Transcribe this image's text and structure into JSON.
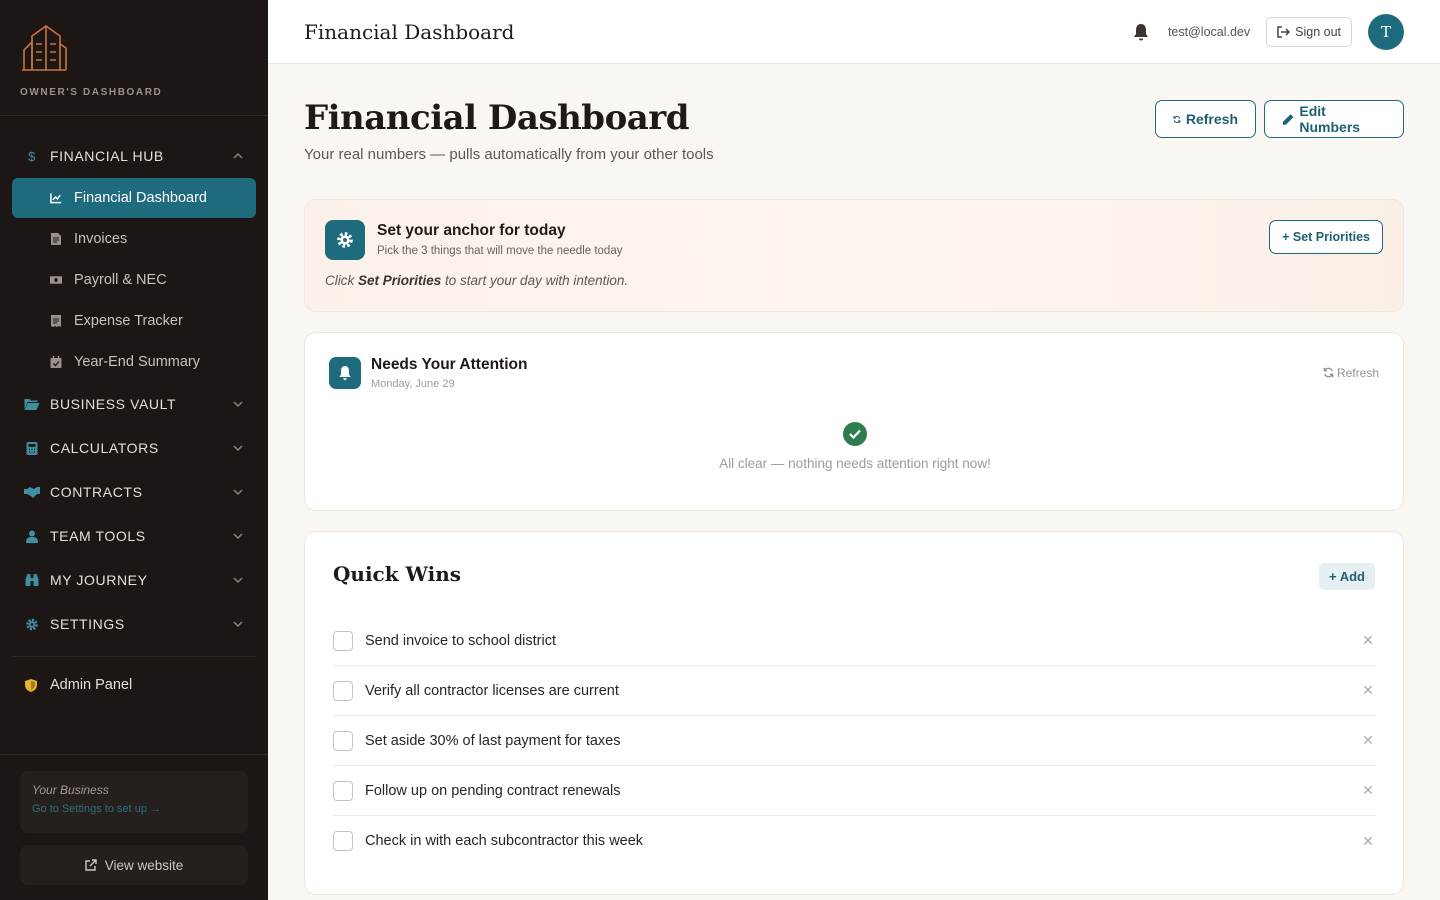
{
  "sidebar": {
    "brand_text": "OWNER'S DASHBOARD",
    "sections": {
      "financial_hub": "FINANCIAL HUB",
      "business_vault": "BUSINESS VAULT",
      "calculators": "CALCULATORS",
      "contracts": "CONTRACTS",
      "team_tools": "TEAM TOOLS",
      "my_journey": "MY JOURNEY",
      "settings": "SETTINGS"
    },
    "financial_items": [
      "Financial Dashboard",
      "Invoices",
      "Payroll & NEC",
      "Expense Tracker",
      "Year-End Summary"
    ],
    "admin_label": "Admin Panel",
    "business_card": {
      "title": "Your Business",
      "link": "Go to Settings to set up →"
    },
    "view_website": "View website"
  },
  "topbar": {
    "title": "Financial Dashboard",
    "user_email": "test@local.dev",
    "sign_out": "Sign out",
    "avatar_initial": "T"
  },
  "page": {
    "title": "Financial Dashboard",
    "subtitle": "Your real numbers — pulls automatically from your other tools",
    "refresh_label": "Refresh",
    "edit_label": "Edit Numbers"
  },
  "anchor": {
    "title": "Set your anchor for today",
    "subtitle": "Pick the 3 things that will move the needle today",
    "note_prefix": "Click ",
    "note_bold": "Set Priorities",
    "note_suffix": " to start your day with intention.",
    "button": "+ Set Priorities"
  },
  "attention": {
    "title": "Needs Your Attention",
    "date": "Monday, June 29",
    "refresh": "Refresh",
    "empty_text": "All clear — nothing needs attention right now!"
  },
  "quick_wins": {
    "title": "Quick Wins",
    "add_label": "+ Add",
    "items": [
      "Send invoice to school district",
      "Verify all contractor licenses are current",
      "Set aside 30% of last payment for taxes",
      "Follow up on pending contract renewals",
      "Check in with each subcontractor this week"
    ]
  },
  "colors": {
    "accent": "#1f6b7e",
    "sidebar_bg": "#1c1715",
    "success": "#2e7d4f",
    "brand_orange": "#c8743e",
    "admin_shield": "#e6b32c"
  }
}
